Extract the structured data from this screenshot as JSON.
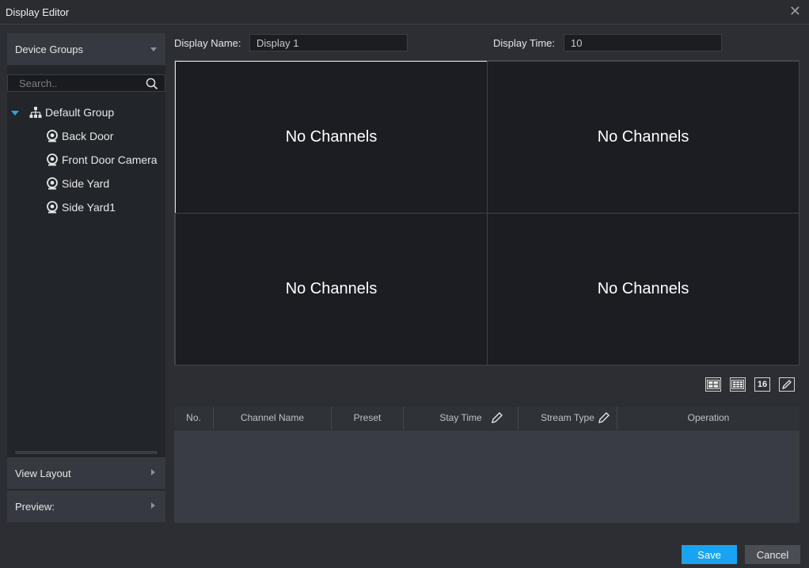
{
  "window": {
    "title": "Display Editor"
  },
  "sidebar": {
    "device_groups_label": "Device Groups",
    "search_placeholder": "Search..",
    "tree": {
      "group": "Default Group",
      "cameras": [
        "Back Door",
        "Front Door Camera",
        "Side Yard",
        "Side Yard1"
      ]
    },
    "view_layout_label": "View Layout",
    "preview_label": "Preview:"
  },
  "form": {
    "display_name_label": "Display Name:",
    "display_name_value": "Display 1",
    "display_time_label": "Display Time:",
    "display_time_value": "10"
  },
  "grid": {
    "cells": [
      "No Channels",
      "No Channels",
      "No Channels",
      "No Channels"
    ],
    "selected_cell": 1
  },
  "layout_buttons": [
    "layout-4-icon",
    "layout-9-icon",
    "16",
    "edit-icon"
  ],
  "table": {
    "columns": [
      "No.",
      "Channel Name",
      "Preset",
      "Stay Time",
      "Stream Type",
      "Operation"
    ],
    "rows": []
  },
  "buttons": {
    "save": "Save",
    "cancel": "Cancel"
  },
  "colors": {
    "accent": "#1aa3f0",
    "expander": "#2aa3e0",
    "background": "#2c2e33"
  }
}
